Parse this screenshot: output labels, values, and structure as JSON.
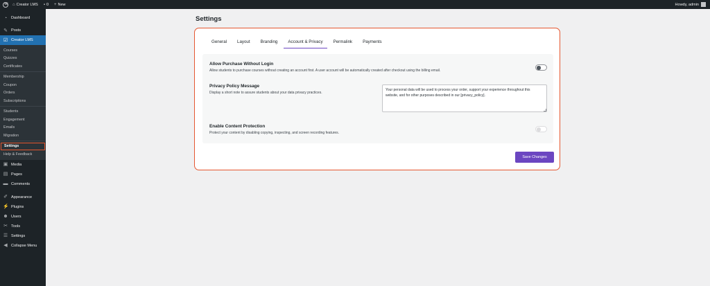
{
  "admin_bar": {
    "site_name": "Creator LMS",
    "comments_count": "0",
    "new_label": "New",
    "howdy": "Howdy, admin"
  },
  "sidebar": {
    "dashboard": "Dashboard",
    "posts": "Posts",
    "creator_lms": "Creator LMS",
    "submenu": [
      "Courses",
      "Quizzes",
      "Certificates",
      "Membership",
      "Coupon",
      "Orders",
      "Subscriptions",
      "Students",
      "Engagement",
      "Emails",
      "Migration",
      "Settings",
      "Help & Feedback"
    ],
    "media": "Media",
    "pages": "Pages",
    "comments": "Comments",
    "appearance": "Appearance",
    "plugins": "Plugins",
    "users": "Users",
    "tools": "Tools",
    "settings": "Settings",
    "collapse": "Collapse Menu"
  },
  "page": {
    "title": "Settings",
    "tabs": [
      "General",
      "Layout",
      "Branding",
      "Account & Privacy",
      "Permalink",
      "Payments"
    ],
    "selected_tab": "Account & Privacy",
    "allow_purchase": {
      "title": "Allow Purchase Without Login",
      "description": "Allow students to purchase courses without creating an account first. A user account will be automatically created after checkout using the billing email."
    },
    "privacy_policy": {
      "title": "Privacy Policy Message",
      "description": "Display a short note to assure students about your data privacy practices.",
      "value": "Your personal data will be used to process your order, support your experience throughout this website, and for other purposes described in our [privacy_policy]."
    },
    "content_protection": {
      "title": "Enable Content Protection",
      "description": "Protect your content by disabling copying, inspecting, and screen recording features."
    },
    "save_label": "Save Changes"
  },
  "colors": {
    "accent": "#6b46c1",
    "highlight_border": "#e5562f",
    "sidebar_bg": "#1d2327",
    "active_menu": "#2271b1"
  }
}
